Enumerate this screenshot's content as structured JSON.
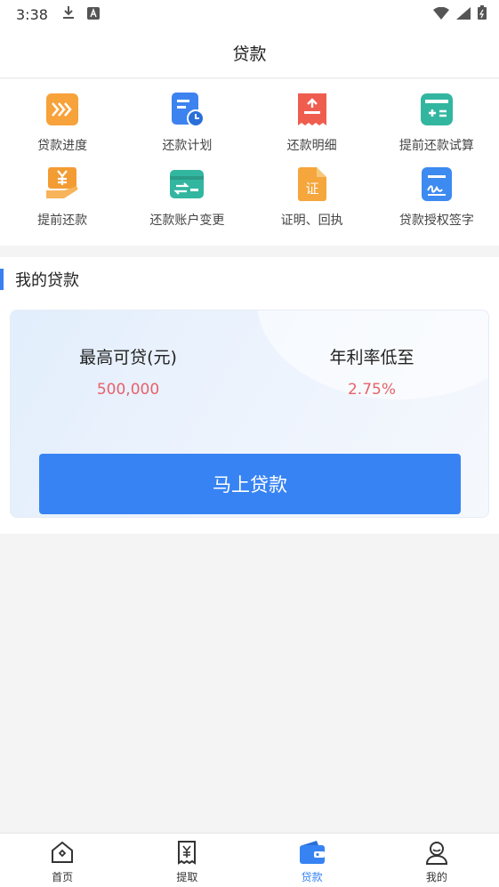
{
  "status_bar": {
    "time": "3:38",
    "icons": [
      "download-icon",
      "a-badge-icon",
      "wifi-icon",
      "signal-icon",
      "battery-icon"
    ]
  },
  "header": {
    "title": "贷款"
  },
  "menu": {
    "items": [
      {
        "label": "贷款进度",
        "icon": "progress-arrows-icon",
        "color": "#f7a23b"
      },
      {
        "label": "还款计划",
        "icon": "schedule-clock-icon",
        "color": "#3d83f0"
      },
      {
        "label": "还款明细",
        "icon": "receipt-icon",
        "color": "#ef5d4f"
      },
      {
        "label": "提前还款试算",
        "icon": "calculator-icon",
        "color": "#33b6a0"
      },
      {
        "label": "提前还款",
        "icon": "yuan-hand-icon",
        "color": "#f39c34"
      },
      {
        "label": "还款账户变更",
        "icon": "card-exchange-icon",
        "color": "#33b6a0"
      },
      {
        "label": "证明、回执",
        "icon": "certificate-icon",
        "color": "#f5a63c"
      },
      {
        "label": "贷款授权签字",
        "icon": "signature-icon",
        "color": "#3d8af0"
      }
    ]
  },
  "my_loan": {
    "title": "我的贷款",
    "max_label": "最高可贷(元)",
    "max_value": "500,000",
    "rate_label": "年利率低至",
    "rate_value": "2.75%",
    "apply_label": "马上贷款"
  },
  "bottom_nav": {
    "items": [
      {
        "label": "首页",
        "icon": "home-icon",
        "active": false
      },
      {
        "label": "提取",
        "icon": "withdraw-icon",
        "active": false
      },
      {
        "label": "贷款",
        "icon": "wallet-icon",
        "active": true
      },
      {
        "label": "我的",
        "icon": "user-icon",
        "active": false
      }
    ]
  },
  "colors": {
    "accent": "#3783f4",
    "highlight": "#e8616a"
  }
}
